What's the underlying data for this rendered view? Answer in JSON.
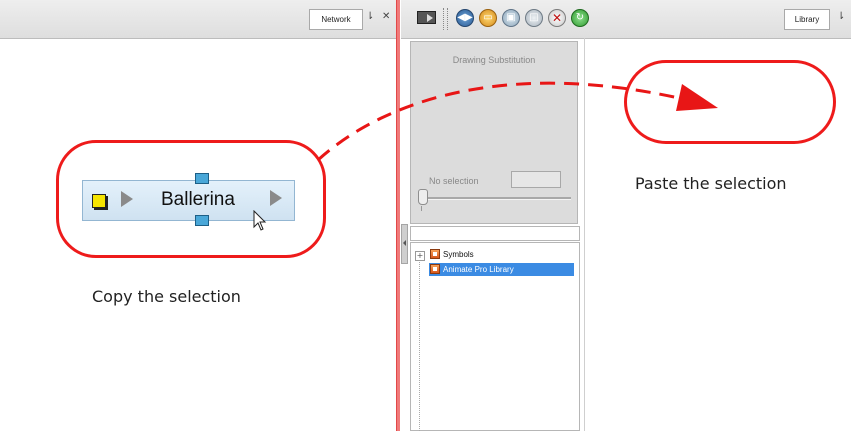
{
  "network_panel": {
    "tab_label": "Network",
    "pin_glyph": "⇂",
    "close_glyph": "✕",
    "node": {
      "label": "Ballerina"
    }
  },
  "library_panel": {
    "tab_label": "Library",
    "pin_glyph": "⇂",
    "toolbar_icons": [
      "film-icon",
      "play-icon",
      "folder-icon",
      "save-icon",
      "stop-icon",
      "delete-icon",
      "refresh-icon"
    ],
    "drawing_substitution": {
      "title": "Drawing Substitution",
      "no_selection_label": "No selection"
    },
    "tree": {
      "items": [
        {
          "label": "Symbols",
          "expanded": false
        },
        {
          "label": "Animate Pro Library",
          "selected": true
        }
      ]
    }
  },
  "annotations": {
    "copy_caption": "Copy the selection",
    "paste_caption": "Paste the selection",
    "highlight_color": "#ee1b1b"
  }
}
